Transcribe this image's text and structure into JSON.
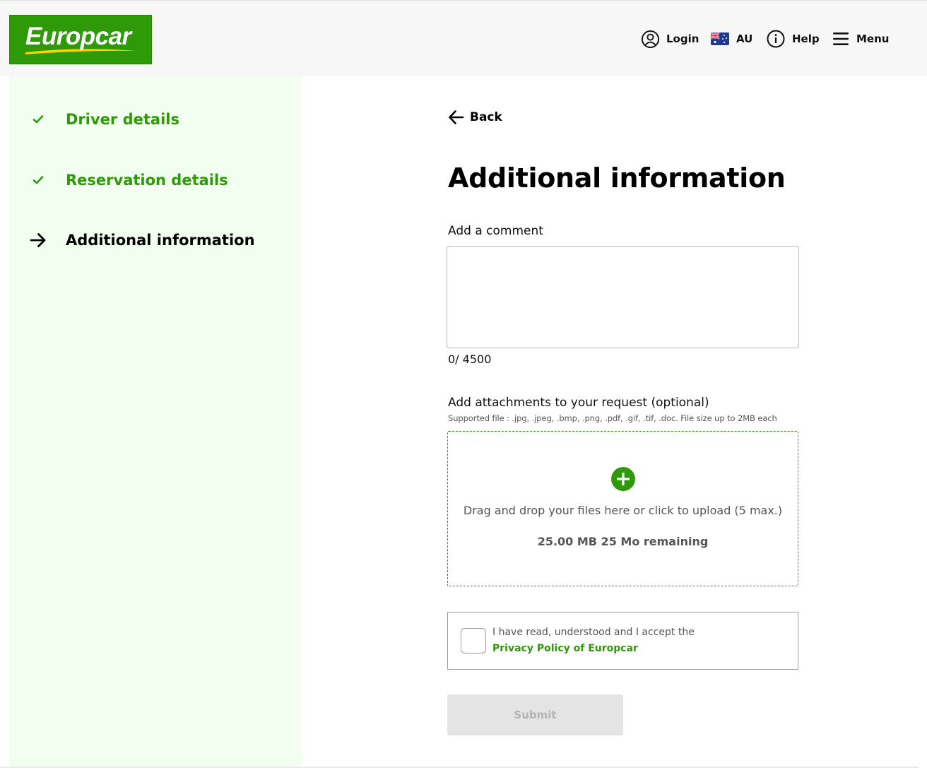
{
  "brand": {
    "name": "Europcar",
    "color": "#2f9a07",
    "swoosh_color": "#ffd200"
  },
  "header": {
    "login_label": "Login",
    "country_label": "AU",
    "country_flag_icon": "australia-flag-icon",
    "help_label": "Help",
    "menu_label": "Menu"
  },
  "steps": [
    {
      "label": "Driver details",
      "status": "done",
      "icon": "checkmark-icon"
    },
    {
      "label": "Reservation details",
      "status": "done",
      "icon": "checkmark-icon"
    },
    {
      "label": "Additional information",
      "status": "current",
      "icon": "arrow-right-icon"
    }
  ],
  "main": {
    "back_label": "Back",
    "title": "Additional information",
    "comment": {
      "label": "Add a comment",
      "value": "",
      "counter": "0/ 4500"
    },
    "attachments": {
      "label": "Add attachments to your request (optional)",
      "hint": "Supported file : .jpg, .jpeg, .bmp, .png, .pdf, .gif, .tif, .doc. File size up to 2MB each",
      "dropzone_text": "Drag and drop your files here or click to upload (5 max.)",
      "remaining": "25.00 MB 25 Mo remaining"
    },
    "consent": {
      "text": "I have read, understood and I accept the",
      "link": "Privacy Policy of Europcar",
      "checked": false
    },
    "submit_label": "Submit"
  }
}
